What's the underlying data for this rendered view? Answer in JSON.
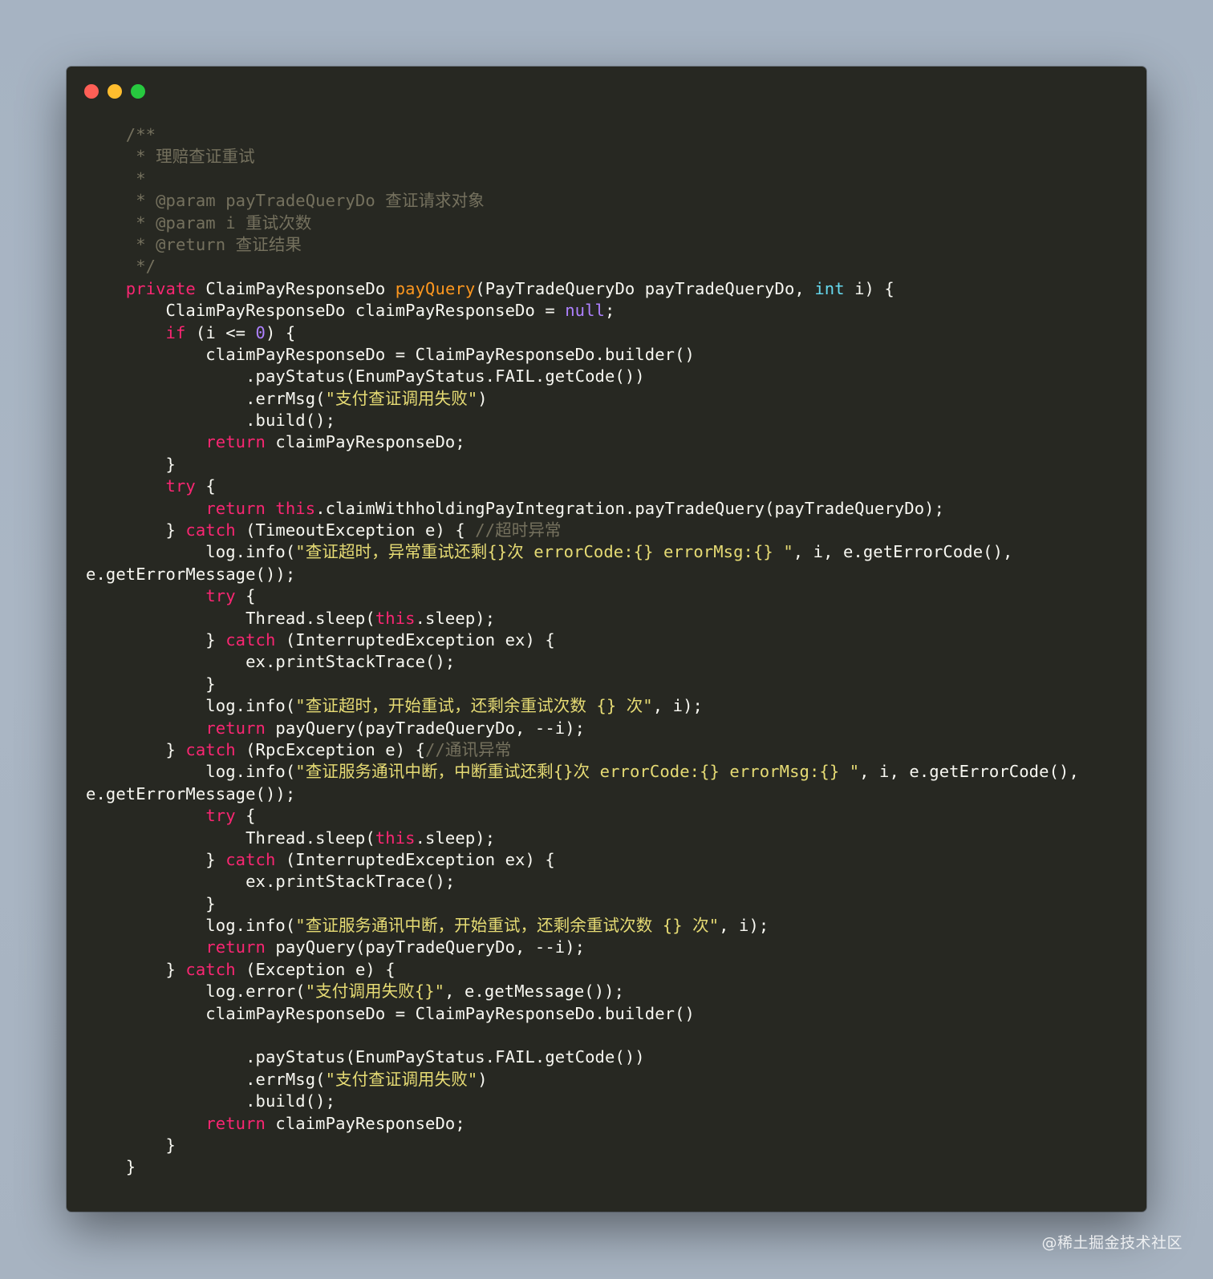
{
  "window": {
    "buttons": [
      {
        "name": "close-button",
        "color": "#ff5f56"
      },
      {
        "name": "minimize-button",
        "color": "#ffbd2e"
      },
      {
        "name": "maximize-button",
        "color": "#27c93f"
      }
    ]
  },
  "code_lines": [
    [
      [
        "comment",
        "    /**"
      ]
    ],
    [
      [
        "comment",
        "     * 理赔查证重试"
      ]
    ],
    [
      [
        "comment",
        "     *"
      ]
    ],
    [
      [
        "comment",
        "     * @param payTradeQueryDo 查证请求对象"
      ]
    ],
    [
      [
        "comment",
        "     * @param i 重试次数"
      ]
    ],
    [
      [
        "comment",
        "     * @return 查证结果"
      ]
    ],
    [
      [
        "comment",
        "     */"
      ]
    ],
    [
      [
        "plain",
        "    "
      ],
      [
        "keyword",
        "private"
      ],
      [
        "plain",
        " ClaimPayResponseDo "
      ],
      [
        "func",
        "payQuery"
      ],
      [
        "plain",
        "(PayTradeQueryDo payTradeQueryDo, "
      ],
      [
        "type",
        "int"
      ],
      [
        "plain",
        " i) {"
      ]
    ],
    [
      [
        "plain",
        "        ClaimPayResponseDo claimPayResponseDo = "
      ],
      [
        "null",
        "null"
      ],
      [
        "plain",
        ";"
      ]
    ],
    [
      [
        "plain",
        "        "
      ],
      [
        "keyword",
        "if"
      ],
      [
        "plain",
        " (i <= "
      ],
      [
        "number",
        "0"
      ],
      [
        "plain",
        ") {"
      ]
    ],
    [
      [
        "plain",
        "            claimPayResponseDo = ClaimPayResponseDo.builder()"
      ]
    ],
    [
      [
        "plain",
        "                .payStatus(EnumPayStatus.FAIL.getCode())"
      ]
    ],
    [
      [
        "plain",
        "                .errMsg("
      ],
      [
        "string",
        "\"支付查证调用失败\""
      ],
      [
        "plain",
        ")"
      ]
    ],
    [
      [
        "plain",
        "                .build();"
      ]
    ],
    [
      [
        "plain",
        "            "
      ],
      [
        "keyword",
        "return"
      ],
      [
        "plain",
        " claimPayResponseDo;"
      ]
    ],
    [
      [
        "plain",
        "        }"
      ]
    ],
    [
      [
        "plain",
        "        "
      ],
      [
        "keyword",
        "try"
      ],
      [
        "plain",
        " {"
      ]
    ],
    [
      [
        "plain",
        "            "
      ],
      [
        "keyword",
        "return"
      ],
      [
        "plain",
        " "
      ],
      [
        "keyword",
        "this"
      ],
      [
        "plain",
        ".claimWithholdingPayIntegration.payTradeQuery(payTradeQueryDo);"
      ]
    ],
    [
      [
        "plain",
        "        } "
      ],
      [
        "keyword",
        "catch"
      ],
      [
        "plain",
        " (TimeoutException e) { "
      ],
      [
        "comment",
        "//超时异常"
      ]
    ],
    [
      [
        "plain",
        "            log.info("
      ],
      [
        "string",
        "\"查证超时，异常重试还剩{}次 errorCode:{} errorMsg:{} \""
      ],
      [
        "plain",
        ", i, e.getErrorCode(),"
      ]
    ],
    [
      [
        "plain",
        "e.getErrorMessage());"
      ]
    ],
    [
      [
        "plain",
        "            "
      ],
      [
        "keyword",
        "try"
      ],
      [
        "plain",
        " {"
      ]
    ],
    [
      [
        "plain",
        "                Thread.sleep("
      ],
      [
        "keyword",
        "this"
      ],
      [
        "plain",
        ".sleep);"
      ]
    ],
    [
      [
        "plain",
        "            } "
      ],
      [
        "keyword",
        "catch"
      ],
      [
        "plain",
        " (InterruptedException ex) {"
      ]
    ],
    [
      [
        "plain",
        "                ex.printStackTrace();"
      ]
    ],
    [
      [
        "plain",
        "            }"
      ]
    ],
    [
      [
        "plain",
        "            log.info("
      ],
      [
        "string",
        "\"查证超时，开始重试，还剩余重试次数 {} 次\""
      ],
      [
        "plain",
        ", i);"
      ]
    ],
    [
      [
        "plain",
        "            "
      ],
      [
        "keyword",
        "return"
      ],
      [
        "plain",
        " payQuery(payTradeQueryDo, --i);"
      ]
    ],
    [
      [
        "plain",
        "        } "
      ],
      [
        "keyword",
        "catch"
      ],
      [
        "plain",
        " (RpcException e) {"
      ],
      [
        "comment",
        "//通讯异常"
      ]
    ],
    [
      [
        "plain",
        "            log.info("
      ],
      [
        "string",
        "\"查证服务通讯中断，中断重试还剩{}次 errorCode:{} errorMsg:{} \""
      ],
      [
        "plain",
        ", i, e.getErrorCode(),"
      ]
    ],
    [
      [
        "plain",
        "e.getErrorMessage());"
      ]
    ],
    [
      [
        "plain",
        "            "
      ],
      [
        "keyword",
        "try"
      ],
      [
        "plain",
        " {"
      ]
    ],
    [
      [
        "plain",
        "                Thread.sleep("
      ],
      [
        "keyword",
        "this"
      ],
      [
        "plain",
        ".sleep);"
      ]
    ],
    [
      [
        "plain",
        "            } "
      ],
      [
        "keyword",
        "catch"
      ],
      [
        "plain",
        " (InterruptedException ex) {"
      ]
    ],
    [
      [
        "plain",
        "                ex.printStackTrace();"
      ]
    ],
    [
      [
        "plain",
        "            }"
      ]
    ],
    [
      [
        "plain",
        "            log.info("
      ],
      [
        "string",
        "\"查证服务通讯中断，开始重试，还剩余重试次数 {} 次\""
      ],
      [
        "plain",
        ", i);"
      ]
    ],
    [
      [
        "plain",
        "            "
      ],
      [
        "keyword",
        "return"
      ],
      [
        "plain",
        " payQuery(payTradeQueryDo, --i);"
      ]
    ],
    [
      [
        "plain",
        "        } "
      ],
      [
        "keyword",
        "catch"
      ],
      [
        "plain",
        " (Exception e) {"
      ]
    ],
    [
      [
        "plain",
        "            log.error("
      ],
      [
        "string",
        "\"支付调用失败{}\""
      ],
      [
        "plain",
        ", e.getMessage());"
      ]
    ],
    [
      [
        "plain",
        "            claimPayResponseDo = ClaimPayResponseDo.builder()"
      ]
    ],
    [
      [
        "plain",
        ""
      ]
    ],
    [
      [
        "plain",
        "                .payStatus(EnumPayStatus.FAIL.getCode())"
      ]
    ],
    [
      [
        "plain",
        "                .errMsg("
      ],
      [
        "string",
        "\"支付查证调用失败\""
      ],
      [
        "plain",
        ")"
      ]
    ],
    [
      [
        "plain",
        "                .build();"
      ]
    ],
    [
      [
        "plain",
        "            "
      ],
      [
        "keyword",
        "return"
      ],
      [
        "plain",
        " claimPayResponseDo;"
      ]
    ],
    [
      [
        "plain",
        "        }"
      ]
    ],
    [
      [
        "plain",
        "    }"
      ]
    ]
  ],
  "watermark": "@稀土掘金技术社区"
}
